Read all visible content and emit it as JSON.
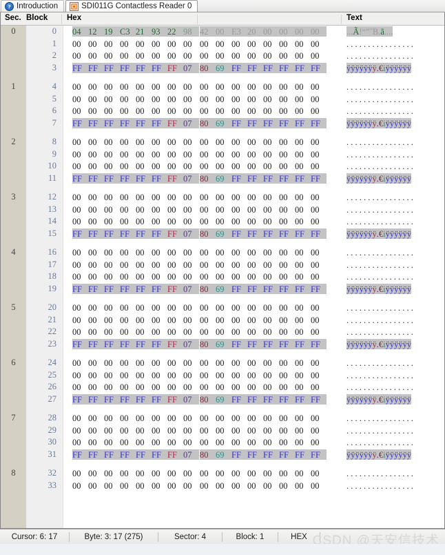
{
  "tabs": [
    {
      "label": "Introduction",
      "icon": "info-circle-icon",
      "active": false
    },
    {
      "label": "SDI011G Contactless Reader 0",
      "icon": "card-reader-icon",
      "active": true
    }
  ],
  "columns": {
    "sector": "Sec.",
    "block": "Block",
    "hex": "Hex",
    "text": "Text"
  },
  "statusbar": {
    "cursor": "Cursor: 6: 17",
    "byte": "Byte: 3: 17  (275)",
    "sector": "Sector: 4",
    "block": "Block: 1",
    "mode": "HEX",
    "watermark": "CSDN @天安信技术"
  },
  "palette": {
    "sector_band": "#d4d0c4",
    "block_band": "#efefef",
    "highlight": "#c3c3c3",
    "zero_byte": "#1c1c1c",
    "green_byte": "#1d6b2c",
    "blue_byte": "#3434cc",
    "red_byte": "#b02a4a",
    "purple_byte": "#5c2d8f",
    "teal_byte": "#2e8c8c",
    "gray_byte": "#9a9a9a"
  },
  "rows": [
    {
      "sector": "0",
      "block": "0",
      "g1": [
        [
          "04",
          "k-green"
        ],
        [
          "12",
          "k-green"
        ],
        [
          "19",
          "k-green"
        ],
        [
          "C3",
          "k-green"
        ],
        [
          "21",
          "k-green"
        ],
        [
          "93",
          "k-green"
        ],
        [
          "22",
          "k-green"
        ],
        [
          "98",
          "k-grn2"
        ]
      ],
      "g2": [
        [
          "42",
          "k-gray"
        ],
        [
          "00",
          "k-gray"
        ],
        [
          "E3",
          "k-gray"
        ],
        [
          "20",
          "k-gray"
        ],
        [
          "00",
          "k-gray"
        ],
        [
          "00",
          "k-gray"
        ],
        [
          "00",
          "k-gray"
        ],
        [
          "00",
          "k-gray"
        ]
      ],
      "text": [
        [
          ".",
          "k-gray"
        ],
        [
          ".",
          "k-gray"
        ],
        [
          ".",
          "k-gray"
        ],
        [
          "Ã",
          "k-green"
        ],
        [
          "!",
          "k-gray"
        ],
        [
          "“",
          "k-gray"
        ],
        [
          "”",
          "k-gray"
        ],
        [
          "˜",
          "k-gray"
        ],
        [
          "B",
          "k-gray"
        ],
        [
          ".",
          "k-gray"
        ],
        [
          "ã",
          "k-green"
        ],
        [
          " ",
          "k-gray"
        ],
        [
          ".",
          "k-gray"
        ],
        [
          ".",
          "k-gray"
        ],
        [
          ".",
          "k-gray"
        ],
        [
          ".",
          "k-gray"
        ]
      ],
      "hl": true
    },
    {
      "sector": "",
      "block": "1",
      "g1": [
        [
          "00",
          "k-zero"
        ],
        [
          "00",
          "k-zero"
        ],
        [
          "00",
          "k-zero"
        ],
        [
          "00",
          "k-zero"
        ],
        [
          "00",
          "k-zero"
        ],
        [
          "00",
          "k-zero"
        ],
        [
          "00",
          "k-zero"
        ],
        [
          "00",
          "k-zero"
        ]
      ],
      "g2": [
        [
          "00",
          "k-zero"
        ],
        [
          "00",
          "k-zero"
        ],
        [
          "00",
          "k-zero"
        ],
        [
          "00",
          "k-zero"
        ],
        [
          "00",
          "k-zero"
        ],
        [
          "00",
          "k-zero"
        ],
        [
          "00",
          "k-zero"
        ],
        [
          "00",
          "k-zero"
        ]
      ],
      "text": "dots",
      "hl": false
    },
    {
      "sector": "",
      "block": "2",
      "g1": [
        [
          "00",
          "k-zero"
        ],
        [
          "00",
          "k-zero"
        ],
        [
          "00",
          "k-zero"
        ],
        [
          "00",
          "k-zero"
        ],
        [
          "00",
          "k-zero"
        ],
        [
          "00",
          "k-zero"
        ],
        [
          "00",
          "k-zero"
        ],
        [
          "00",
          "k-zero"
        ]
      ],
      "g2": [
        [
          "00",
          "k-zero"
        ],
        [
          "00",
          "k-zero"
        ],
        [
          "00",
          "k-zero"
        ],
        [
          "00",
          "k-zero"
        ],
        [
          "00",
          "k-zero"
        ],
        [
          "00",
          "k-zero"
        ],
        [
          "00",
          "k-zero"
        ],
        [
          "00",
          "k-zero"
        ]
      ],
      "text": "dots",
      "hl": false
    },
    {
      "sector": "",
      "block": "3",
      "trailer": true
    },
    {
      "gap": true
    },
    {
      "sector": "1",
      "block": "4",
      "zero": true
    },
    {
      "sector": "",
      "block": "5",
      "zero": true
    },
    {
      "sector": "",
      "block": "6",
      "zero": true
    },
    {
      "sector": "",
      "block": "7",
      "trailer": true
    },
    {
      "gap": true
    },
    {
      "sector": "2",
      "block": "8",
      "zero": true
    },
    {
      "sector": "",
      "block": "9",
      "zero": true
    },
    {
      "sector": "",
      "block": "10",
      "zero": true
    },
    {
      "sector": "",
      "block": "11",
      "trailer": true
    },
    {
      "gap": true
    },
    {
      "sector": "3",
      "block": "12",
      "zero": true
    },
    {
      "sector": "",
      "block": "13",
      "zero": true
    },
    {
      "sector": "",
      "block": "14",
      "zero": true
    },
    {
      "sector": "",
      "block": "15",
      "trailer": true
    },
    {
      "gap": true
    },
    {
      "sector": "4",
      "block": "16",
      "zero": true
    },
    {
      "sector": "",
      "block": "17",
      "zero": true
    },
    {
      "sector": "",
      "block": "18",
      "zero": true
    },
    {
      "sector": "",
      "block": "19",
      "trailer": true
    },
    {
      "gap": true
    },
    {
      "sector": "5",
      "block": "20",
      "zero": true
    },
    {
      "sector": "",
      "block": "21",
      "zero": true
    },
    {
      "sector": "",
      "block": "22",
      "zero": true
    },
    {
      "sector": "",
      "block": "23",
      "trailer": true
    },
    {
      "gap": true
    },
    {
      "sector": "6",
      "block": "24",
      "zero": true
    },
    {
      "sector": "",
      "block": "25",
      "zero": true
    },
    {
      "sector": "",
      "block": "26",
      "zero": true
    },
    {
      "sector": "",
      "block": "27",
      "trailer": true
    },
    {
      "gap": true
    },
    {
      "sector": "7",
      "block": "28",
      "zero": true
    },
    {
      "sector": "",
      "block": "29",
      "zero": true
    },
    {
      "sector": "",
      "block": "30",
      "zero": true
    },
    {
      "sector": "",
      "block": "31",
      "trailer": true
    },
    {
      "gap": true
    },
    {
      "sector": "8",
      "block": "32",
      "zero": true
    },
    {
      "sector": "",
      "block": "33",
      "zero": true
    }
  ],
  "templates": {
    "zero_group": [
      "00",
      "00",
      "00",
      "00",
      "00",
      "00",
      "00",
      "00"
    ],
    "trailer_g1": [
      [
        "FF",
        "k-blue"
      ],
      [
        "FF",
        "k-blue"
      ],
      [
        "FF",
        "k-blue"
      ],
      [
        "FF",
        "k-blue"
      ],
      [
        "FF",
        "k-blue"
      ],
      [
        "FF",
        "k-blue"
      ],
      [
        "FF",
        "k-red"
      ],
      [
        "07",
        "k-pur"
      ]
    ],
    "trailer_g2": [
      [
        "80",
        "k-dred"
      ],
      [
        "69",
        "k-teal"
      ],
      [
        "FF",
        "k-blue"
      ],
      [
        "FF",
        "k-blue"
      ],
      [
        "FF",
        "k-blue"
      ],
      [
        "FF",
        "k-blue"
      ],
      [
        "FF",
        "k-blue"
      ],
      [
        "FF",
        "k-blue"
      ]
    ],
    "trailer_text": [
      [
        "ÿ",
        "k-blue"
      ],
      [
        "ÿ",
        "k-blue"
      ],
      [
        "ÿ",
        "k-blue"
      ],
      [
        "ÿ",
        "k-blue"
      ],
      [
        "ÿ",
        "k-blue"
      ],
      [
        "ÿ",
        "k-blue"
      ],
      [
        "ÿ",
        "k-red"
      ],
      [
        ".",
        "k-pur"
      ],
      [
        "€",
        "k-dred"
      ],
      [
        "i",
        "k-teal"
      ],
      [
        "ÿ",
        "k-blue"
      ],
      [
        "ÿ",
        "k-blue"
      ],
      [
        "ÿ",
        "k-blue"
      ],
      [
        "ÿ",
        "k-blue"
      ],
      [
        "ÿ",
        "k-blue"
      ],
      [
        "ÿ",
        "k-blue"
      ]
    ],
    "dots_text": ". . . . . . . . . . . . . . . ."
  }
}
